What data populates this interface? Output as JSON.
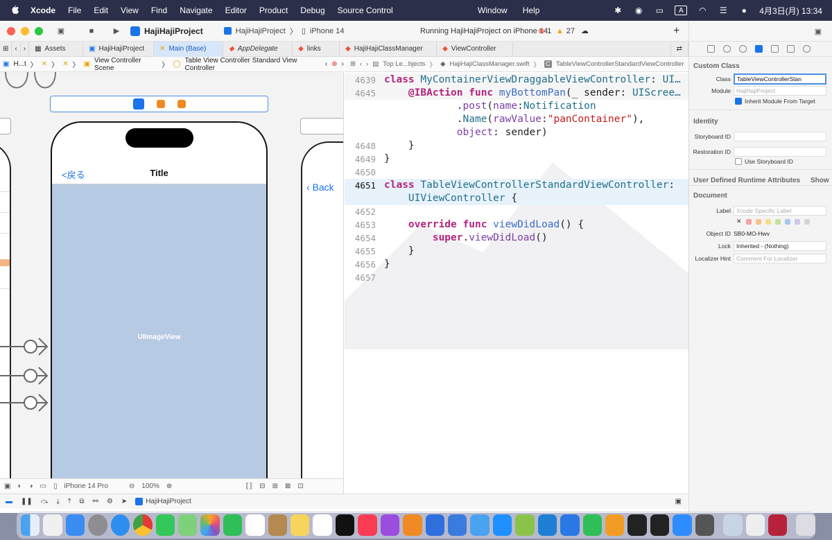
{
  "menubar": {
    "app_name": "Xcode",
    "items": [
      "File",
      "Edit",
      "View",
      "Find",
      "Navigate",
      "Editor",
      "Product",
      "Debug",
      "Source Control"
    ],
    "right_items": [
      "Window",
      "Help"
    ],
    "input_indicator": "A",
    "clock": "4月3日(月)  13:34"
  },
  "toolbar": {
    "project": "HajiHajiProject",
    "scheme": "HajiHajiProject",
    "destination": "iPhone 14",
    "run_status": "Running HajiHajiProject on iPhone 14",
    "errors": "1",
    "warnings": "27"
  },
  "tabs": [
    {
      "label": "Assets"
    },
    {
      "label": "HajiHajiProject"
    },
    {
      "label": "Main (Base)"
    },
    {
      "label": "AppDelegate"
    },
    {
      "label": "links"
    },
    {
      "label": "HajiHajiClassManager"
    },
    {
      "label": "ViewController"
    }
  ],
  "jumpbar_left": {
    "first": "H...t",
    "scene": "View Controller Scene",
    "controller": "Table View Controller Standard View Controller"
  },
  "jumpbar_right": {
    "crumb1": "Top Le...bjects",
    "file": "HajiHajiClassManager.swift",
    "class": "TableViewControllerStandardViewController"
  },
  "storyboard": {
    "nav_back": "<戻る",
    "nav_title": "Title",
    "image_view_label": "UIImageView",
    "right_back": "Back",
    "device": "iPhone 14 Pro",
    "zoom": "100%"
  },
  "code": {
    "n4639": "4639",
    "n4645": "4645",
    "n4648": "4648",
    "n4649": "4649",
    "n4650": "4650",
    "n4651": "4651",
    "n4652": "4652",
    "n4653": "4653",
    "n4654": "4654",
    "n4655": "4655",
    "n4656": "4656",
    "n4657": "4657"
  },
  "inspector": {
    "custom_class_title": "Custom Class",
    "class_label": "Class",
    "class_value": "TableViewControllerStan",
    "module_label": "Module",
    "module_placeholder": "HajiHajiProject",
    "inherit_label": "Inherit Module From Target",
    "identity_title": "Identity",
    "storyboard_id_label": "Storyboard ID",
    "restoration_id_label": "Restoration ID",
    "use_storyboard_id": "Use Storyboard ID",
    "udra_title": "User Defined Runtime Attributes",
    "show": "Show",
    "document_title": "Document",
    "label_label": "Label",
    "label_placeholder": "Xcode Specific Label",
    "object_id_label": "Object ID",
    "object_id_value": "SB0-MO-Hwv",
    "lock_label": "Lock",
    "lock_value": "Inherited - (Nothing)",
    "localizer_label": "Localizer Hint",
    "localizer_placeholder": "Comment For Localizer"
  },
  "statusbar": {
    "target": "HajiHajiProject"
  }
}
